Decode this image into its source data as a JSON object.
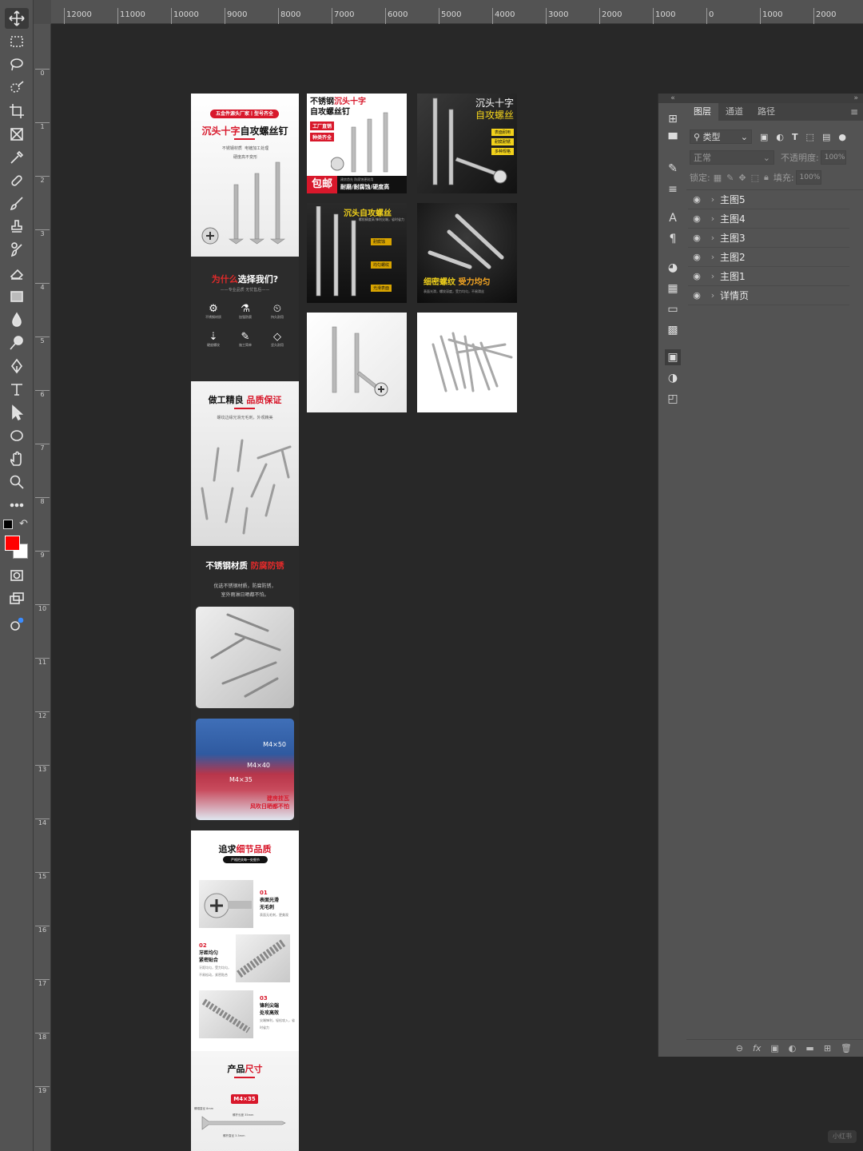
{
  "ruler_top_labels": [
    "12000",
    "11000",
    "10000",
    "9000",
    "8000",
    "7000",
    "6000",
    "5000",
    "4000",
    "3000",
    "2000",
    "1000",
    "0",
    "1000",
    "2000"
  ],
  "ruler_left_labels": [
    "0",
    "1",
    "2",
    "3",
    "4",
    "5",
    "6",
    "7",
    "8",
    "9",
    "10",
    "11",
    "12",
    "13",
    "14",
    "15",
    "16",
    "17",
    "18",
    "19"
  ],
  "colors": {
    "foreground": "#ff0000",
    "background": "#ffffff",
    "accent_red": "#d8182b"
  },
  "toolbar_icons": [
    "move-icon",
    "marquee-icon",
    "lasso-icon",
    "quick-select-icon",
    "crop-icon",
    "frame-icon",
    "eyedropper-icon",
    "healing-icon",
    "brush-icon",
    "stamp-icon",
    "history-brush-icon",
    "eraser-icon",
    "gradient-icon",
    "blur-icon",
    "dodge-icon",
    "pen-icon",
    "type-icon",
    "path-select-icon",
    "ellipse-icon",
    "hand-icon",
    "zoom-icon",
    "more-icon"
  ],
  "boards": {
    "detail_page": {
      "s1_badge": "五金件源头厂家丨型号齐全",
      "s1_title_red": "沉头十字",
      "s1_title_dark": "自攻螺丝钉",
      "s1_features": [
        "不锈钢材质",
        "电镀加工处理",
        "硬度高不变形"
      ],
      "s2_title_red": "为什么",
      "s2_title_white": "选择我们?",
      "s2_sub": "——专业品质 无忧售后——",
      "s2_icons": [
        "不锈钢材质",
        "加强防腐",
        "持久耐用",
        "硬度螺纹",
        "施工简单",
        "坚久耐用"
      ],
      "s3_title_dark": "做工精良",
      "s3_title_red": "品质保证",
      "s3_sub": "螺纹边缘光滑无毛刺，外观精美",
      "s4_title_white": "不锈钢材质",
      "s4_title_red": "防腐防锈",
      "s4_sub1": "优选不锈钢材质，防腐防锈，",
      "s4_sub2": "室外雨淋日晒都不怕。",
      "s4_labels": [
        "M4×50",
        "M4×40",
        "M4×35"
      ],
      "s4_caption1": "建房挂瓦",
      "s4_caption2": "风吹日晒都不怕",
      "s5_title_dark": "追求",
      "s5_title_red": "细节品质",
      "s5_badge": "严格把关每一处细节",
      "s5_items": [
        {
          "num": "01",
          "title1": "表面光滑",
          "title2": "无毛刺",
          "desc": "表面无毛刺，更美观"
        },
        {
          "num": "02",
          "title1": "牙距均匀",
          "title2": "紧密贴合",
          "desc": "牙距均匀，受力均匀，不易松动，紧密贴合"
        },
        {
          "num": "03",
          "title1": "锋利尖端",
          "title2": "处攻高效",
          "desc": "尖端锋利，轻松攻入，省时省力"
        }
      ],
      "s6_title_dark": "产品",
      "s6_title_red": "尺寸",
      "s6_size": "M4×35",
      "s6_dims": [
        "螺帽直径 8mm",
        "螺杆长度 35mm",
        "螺杆直径 3.5mm"
      ]
    },
    "main1": {
      "title1_dark": "不锈钢",
      "title1_red": "沉头十字",
      "title2": "自攻螺丝钉",
      "tags": [
        "工厂直销",
        "种类齐全"
      ],
      "bottom_red": "包邮",
      "bottom_dark": "耐磨/耐腐蚀/硬度高",
      "bottom_top": "建房首先 防腐蚀更耐用"
    },
    "main2": {
      "title1": "沉头十字",
      "title2": "自攻螺丝",
      "tags": [
        "表面耐用",
        "耐腐耐锈",
        "多种规格"
      ]
    },
    "main3": {
      "title": "沉头自攻螺丝",
      "sub": "螺纹精度高 锋利尖端，省时省力",
      "tags": [
        "耐腐蚀",
        "均匀螺纹",
        "光滑表面"
      ]
    },
    "main4": {
      "title_gold": "细密螺纹",
      "title_orange": "受力均匀",
      "sub": "表面光滑，螺纹深度，受力均匀，不易滑丝"
    }
  },
  "layers_panel": {
    "tabs": [
      "图层",
      "通道",
      "路径"
    ],
    "filter_label": "类型",
    "blend_mode": "正常",
    "opacity_label": "不透明度:",
    "opacity_value": "100%",
    "lock_label": "锁定:",
    "fill_label": "填充:",
    "fill_value": "100%",
    "layers": [
      "主图5",
      "主图4",
      "主图3",
      "主图2",
      "主图1",
      "详情页"
    ]
  },
  "watermark": "小红书"
}
